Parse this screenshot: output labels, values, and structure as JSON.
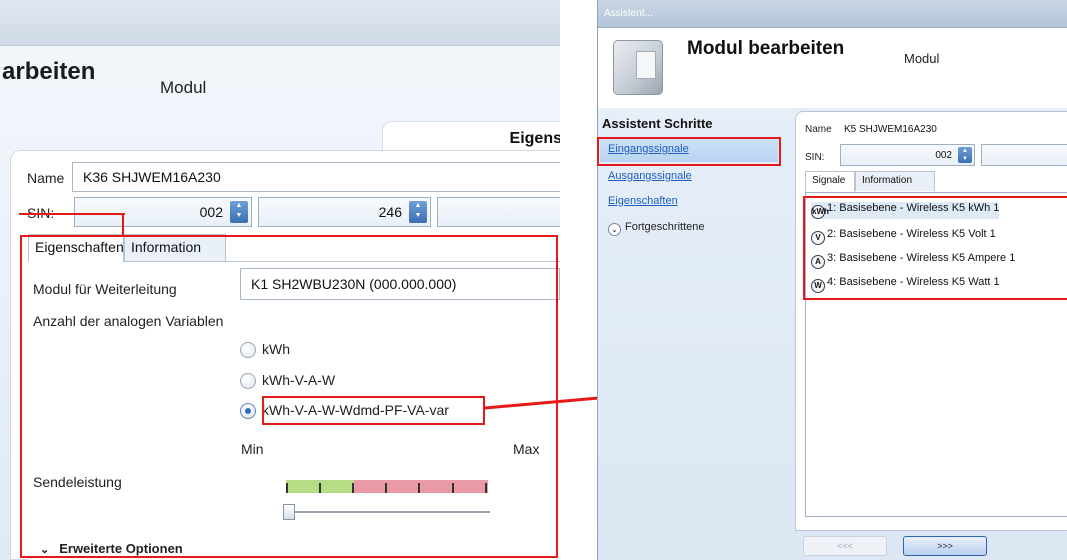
{
  "left": {
    "title": "arbeiten",
    "subtitle": "Modul",
    "section_tab": "Eigens",
    "name_label": "Name",
    "name_value": "K36 SHJWEM16A230",
    "sin_label": "SIN:",
    "sin_values": [
      "002",
      "246",
      ""
    ],
    "tabs": [
      {
        "label": "Eigenschaften",
        "active": true
      },
      {
        "label": "Information",
        "active": false
      }
    ],
    "forward_label": "Modul für Weiterleitung",
    "forward_value": "K1 SH2WBU230N (000.000.000)",
    "count_label": "Anzahl der analogen Variablen",
    "options": [
      {
        "label": "kWh",
        "checked": false
      },
      {
        "label": "kWh-V-A-W",
        "checked": false
      },
      {
        "label": "kWh-V-A-W-Wdmd-PF-VA-var",
        "checked": true
      }
    ],
    "min_label": "Min",
    "max_label": "Max",
    "power_label": "Sendeleistung",
    "power_level": 0,
    "advanced_label": "Erweiterte Optionen",
    "colors": {
      "green": "#b5dd86",
      "red": "#ea9aa6",
      "annotation": "#e61919"
    }
  },
  "right": {
    "window_title": "Assistent...",
    "title": "Modul bearbeiten",
    "subtitle": "Modul",
    "steps_header": "Assistent Schritte",
    "steps": [
      {
        "label": "Eingangssignale",
        "active": true
      },
      {
        "label": "Ausgangssignale",
        "active": false
      },
      {
        "label": "Eigenschaften",
        "active": false
      }
    ],
    "advanced_label": "Fortgeschrittene",
    "name_label": "Name",
    "name_value": "K5 SHJWEM16A230",
    "sin_label": "SIN:",
    "sin_values": [
      "002",
      ""
    ],
    "tabs": [
      {
        "label": "Signale",
        "active": true
      },
      {
        "label": "Information",
        "active": false
      }
    ],
    "signals": [
      {
        "icon": "kWh",
        "label": "1: Basisebene - Wireless K5 kWh 1"
      },
      {
        "icon": "V",
        "label": "2: Basisebene - Wireless K5 Volt 1"
      },
      {
        "icon": "A",
        "label": "3: Basisebene - Wireless K5 Ampere 1"
      },
      {
        "icon": "W",
        "label": "4: Basisebene - Wireless K5 Watt 1"
      }
    ],
    "prev_label": "<<<",
    "next_label": ">>>"
  }
}
